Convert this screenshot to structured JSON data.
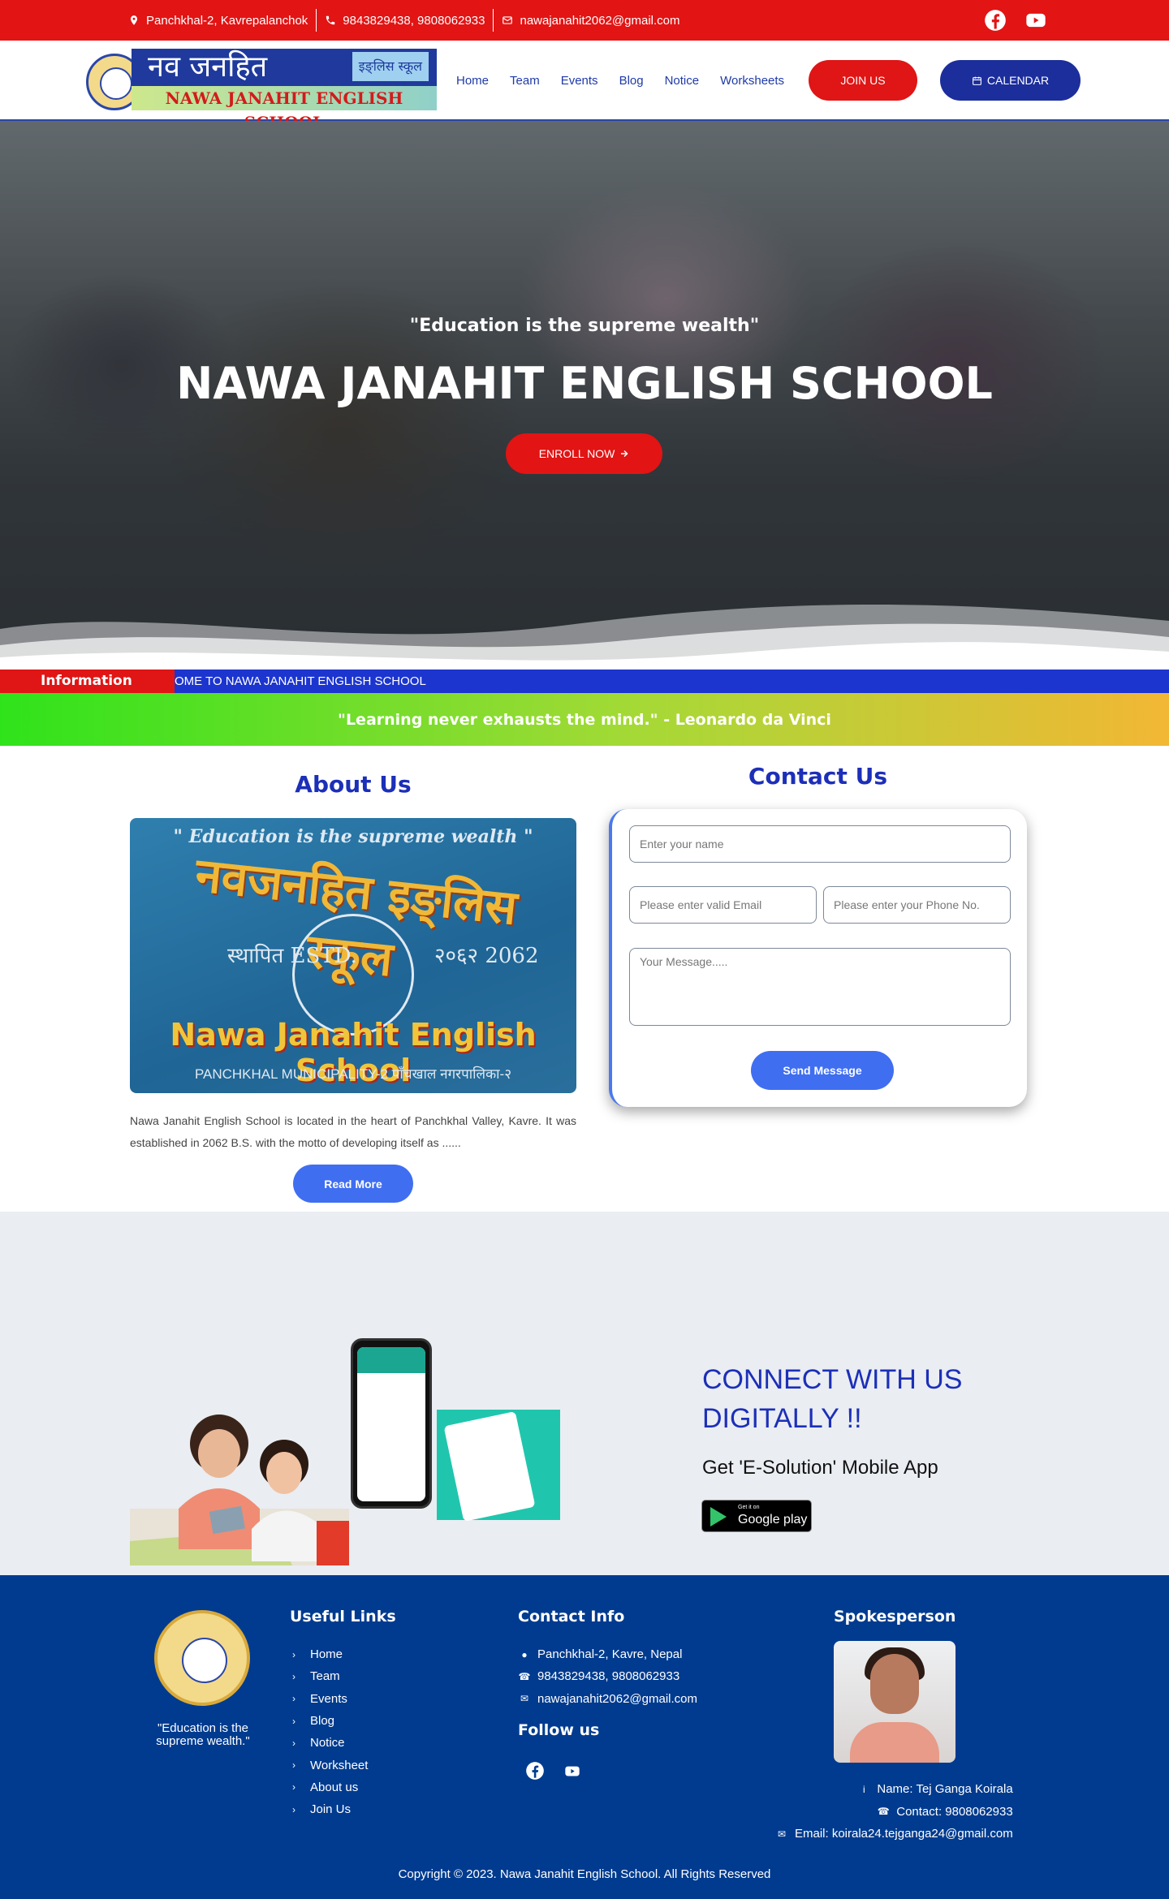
{
  "topbar": {
    "address": "Panchkhal-2, Kavrepalanchok",
    "phones": "9843829438, 9808062933",
    "email": "nawajanahit2062@gmail.com",
    "social": [
      "facebook-icon",
      "youtube-icon"
    ]
  },
  "nav": {
    "logo_devanagari": "नव जनहित",
    "logo_devanagari_small": "इङ्लिस स्कूल",
    "logo_english": "NAWA JANAHIT ENGLISH SCHOOL",
    "items": [
      "Home",
      "Team",
      "Events",
      "Blog",
      "Notice",
      "Worksheets"
    ],
    "join_label": "JOIN US",
    "calendar_label": "CALENDAR"
  },
  "hero": {
    "quote": "\"Education is the supreme wealth\"",
    "title": "NAWA JANAHIT ENGLISH SCHOOL",
    "enroll_label": "ENROLL NOW"
  },
  "ticker": {
    "label": "Information",
    "text": "OME TO NAWA JANAHIT ENGLISH SCHOOL"
  },
  "quote_band": "\"Learning never exhausts the mind.\" - Leonardo da Vinci",
  "about": {
    "heading": "About Us",
    "image_quote": "\" Education is the supreme wealth \"",
    "image_devanagari": "नवजनहित इङ्लिस स्कूल",
    "image_estd_left": "स्थापित ESTD.",
    "image_estd_right": "२०६२ 2062",
    "image_english": "Nawa Janahit English School",
    "image_municipality": "PANCHKHAL MUNICIPALITY-2   पाँचखाल नगरपालिका-२",
    "paragraph": "Nawa Janahit English School is located in the heart of Panchkhal Valley, Kavre. It was established in 2062 B.S. with the motto of developing itself as ......",
    "read_more_label": "Read More"
  },
  "contact": {
    "heading": "Contact Us",
    "name_placeholder": "Enter your name",
    "email_placeholder": "Please enter valid Email",
    "phone_placeholder": "Please enter your Phone No.",
    "message_placeholder": "Your Message.....",
    "send_label": "Send Message"
  },
  "app": {
    "heading": "CONNECT WITH US DIGITALLY !!",
    "subheading": "Get 'E-Solution' Mobile App",
    "badge_small": "Get it on",
    "badge_large": "Google play"
  },
  "footer": {
    "tagline": "\"Education is the supreme wealth.\"",
    "useful_links_heading": "Useful Links",
    "links": [
      "Home",
      "Team",
      "Events",
      "Blog",
      "Notice",
      "Worksheet",
      "About us",
      "Join Us"
    ],
    "contact_heading": "Contact Info",
    "contact_address": "Panchkhal-2, Kavre, Nepal",
    "contact_phones": "9843829438, 9808062933",
    "contact_email": "nawajanahit2062@gmail.com",
    "follow_heading": "Follow us",
    "spokesperson_heading": "Spokesperson",
    "spokesperson_name": "Name: Tej Ganga Koirala",
    "spokesperson_contact": "Contact: 9808062933",
    "spokesperson_email": "Email: koirala24.tejganga24@gmail.com",
    "copyright": "Copyright © 2023. Nawa Janahit English School. All Rights Reserved"
  },
  "colors": {
    "topbar_red": "#e21414",
    "brand_blue": "#1c2fb8",
    "button_blue": "#3f6ef1",
    "footer_blue": "#003b8f"
  }
}
